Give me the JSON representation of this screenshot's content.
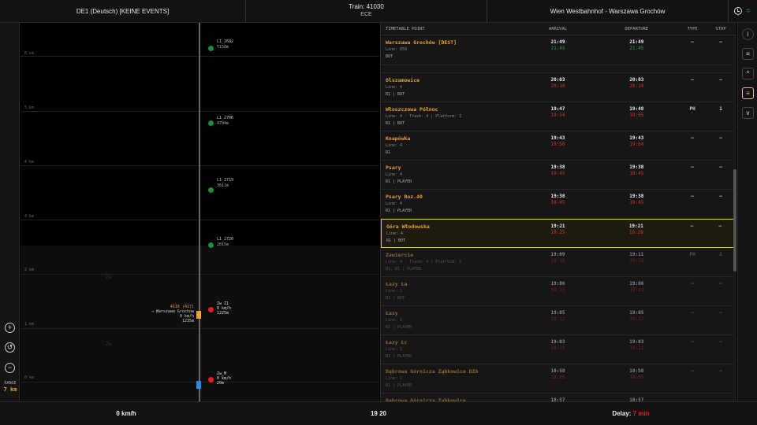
{
  "header": {
    "language_info": "DE1 (Deutsch) [KEINE EVENTS]",
    "train_label": "Train: 41030",
    "train_type": "ECE",
    "route": "Wien Westbahnhof - Warszawa Grochów"
  },
  "left_panel": {
    "range_label": "RANGE",
    "range_value": "7 km",
    "zoom_in": "+",
    "reset": "↺",
    "zoom_out": "−"
  },
  "graph": {
    "km_labels": [
      "6 km",
      "5 km",
      "4 km",
      "4 km",
      "2 km",
      "1 km",
      "0 km"
    ],
    "stations": [
      {
        "name": "L1_2692",
        "dist": "5158m"
      },
      {
        "name": "L1_2706",
        "dist": "4704m"
      },
      {
        "name": "L1_2719",
        "dist": "3611m"
      },
      {
        "name": "L1_2720",
        "dist": "2815m"
      }
    ],
    "signals": [
      {
        "name": "Zw Z1",
        "speed": "0 km/h",
        "dist": "1225m"
      },
      {
        "name": "Zw_M",
        "speed": "0 km/h",
        "dist": "20m"
      }
    ],
    "other_train": {
      "number": "4116 (417)",
      "dest": "→ Warszawa Grochów",
      "speed": "0 km/h",
      "dist": "1235m"
    },
    "ghost_labels": [
      "Zw",
      "Zw"
    ]
  },
  "table": {
    "headers": {
      "point": "TIMETABLE POINT",
      "arrival": "ARRIVAL",
      "departure": "DEPARTURE",
      "type": "TYPE",
      "stop": "STOP"
    },
    "rows": [
      {
        "name": "Warszawa Grochów [DEST]",
        "meta": "Line: 859",
        "icons": "BOT",
        "arr": "21:49",
        "arr_act": "21:45",
        "dep": "21:49",
        "dep_act": "21:45",
        "type": "–",
        "stop": "–",
        "ok": true,
        "dim": false,
        "hl": false,
        "short": true
      },
      {
        "name": "Olszamowice",
        "meta": "Line: 4",
        "icons": "R1 | BOT",
        "arr": "20:03",
        "arr_act": "20:10",
        "dep": "20:03",
        "dep_act": "20:10",
        "type": "–",
        "stop": "–",
        "dim": false,
        "hl": false
      },
      {
        "name": "Włoszczowa Północ",
        "meta": "Line: 4 · Track: 4 | Platform: I",
        "icons": "R1 | BOT",
        "arr": "19:47",
        "arr_act": "19:54",
        "dep": "19:48",
        "dep_act": "19:55",
        "type": "PH",
        "stop": "1",
        "dim": false,
        "hl": false
      },
      {
        "name": "Knapówka",
        "meta": "Line: 4",
        "icons": "R1",
        "arr": "19:43",
        "arr_act": "19:50",
        "dep": "19:43",
        "dep_act": "19:50",
        "type": "–",
        "stop": "–",
        "dim": false,
        "hl": false
      },
      {
        "name": "Psary",
        "meta": "Line: 4",
        "icons": "R1 | PLAYER",
        "arr": "19:38",
        "arr_act": "19:45",
        "dep": "19:38",
        "dep_act": "19:45",
        "type": "–",
        "stop": "–",
        "dim": false,
        "hl": false
      },
      {
        "name": "Psary Roz.40",
        "meta": "Line: 4",
        "icons": "R1 | PLAYER",
        "arr": "19:38",
        "arr_act": "19:45",
        "dep": "19:38",
        "dep_act": "19:45",
        "type": "–",
        "stop": "–",
        "dim": false,
        "hl": false
      },
      {
        "name": "Góra Włodowska",
        "meta": "Line: 4",
        "icons": "R1 | BOT",
        "arr": "19:21",
        "arr_act": "19:25",
        "dep": "19:21",
        "dep_act": "19:28",
        "type": "–",
        "stop": "–",
        "dim": false,
        "hl": true
      },
      {
        "name": "Zawiercie",
        "meta": "Line: 4 · Track: 4 | Platform: I",
        "icons": "R1, R1 | PLAYER",
        "arr": "19:09",
        "arr_act": "19:16",
        "dep": "19:11",
        "dep_act": "19:18",
        "type": "PH",
        "stop": "2",
        "dim": true,
        "hl": false
      },
      {
        "name": "Łazy Ła",
        "meta": "Line: 1",
        "icons": "R1 | BOT",
        "arr": "19:06",
        "arr_act": "19:13",
        "dep": "19:06",
        "dep_act": "19:13",
        "type": "–",
        "stop": "–",
        "dim": true,
        "hl": false
      },
      {
        "name": "Łazy",
        "meta": "Line: 1",
        "icons": "R1 | PLAYER",
        "arr": "19:05",
        "arr_act": "19:12",
        "dep": "19:05",
        "dep_act": "19:12",
        "type": "–",
        "stop": "–",
        "dim": true,
        "hl": false
      },
      {
        "name": "Łazy Łc",
        "meta": "Line: 1",
        "icons": "R1 | PLAYER",
        "arr": "19:03",
        "arr_act": "19:11",
        "dep": "19:03",
        "dep_act": "19:11",
        "type": "–",
        "stop": "–",
        "dim": true,
        "hl": false
      },
      {
        "name": "Dąbrowa Górnicza Ząbkowice DZA",
        "meta": "Line: 1",
        "icons": "R1 | PLAYER",
        "arr": "18:58",
        "arr_act": "19:05",
        "dep": "18:58",
        "dep_act": "19:05",
        "type": "–",
        "stop": "–",
        "dim": true,
        "hl": false
      },
      {
        "name": "Dąbrowa Górnicza Ząbkowice",
        "meta": "",
        "icons": "",
        "arr": "18:57",
        "arr_act": "",
        "dep": "18:57",
        "dep_act": "",
        "type": "",
        "stop": "",
        "dim": true,
        "hl": false
      }
    ]
  },
  "right_panel": {
    "info": "i",
    "list": "≡",
    "up": "^",
    "jump": "≡",
    "down": "v"
  },
  "footer": {
    "speed": "0 km/h",
    "time": "19 20",
    "delay_label": "Delay:",
    "delay_value": "7 min"
  }
}
